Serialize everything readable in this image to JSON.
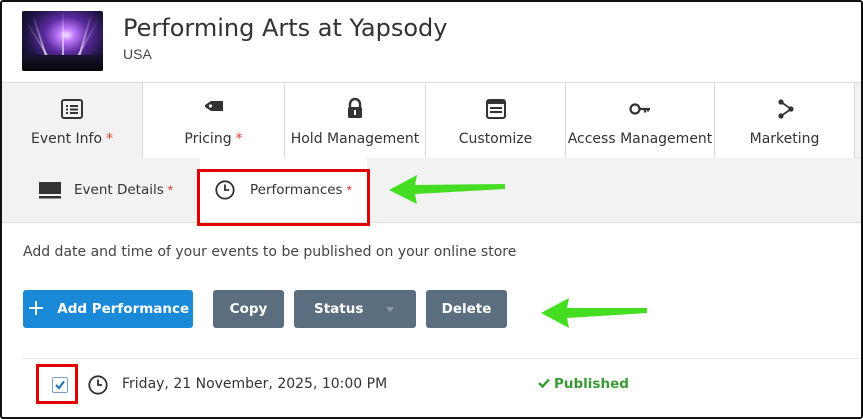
{
  "event": {
    "title": "Performing Arts at Yapsody",
    "location": "USA"
  },
  "main_tabs": [
    {
      "label": "Event Info",
      "required": "*",
      "icon": "list-icon"
    },
    {
      "label": "Pricing",
      "required": "*",
      "icon": "tag-icon"
    },
    {
      "label": "Hold Management",
      "icon": "lock-icon"
    },
    {
      "label": "Customize",
      "icon": "layout-icon"
    },
    {
      "label": "Access Management",
      "icon": "key-icon"
    },
    {
      "label": "Marketing",
      "icon": "share-icon"
    }
  ],
  "sub_tabs": [
    {
      "label": "Event Details",
      "required": "*",
      "icon": "monitor-icon"
    },
    {
      "label": "Performances",
      "required": "*",
      "icon": "clock-icon"
    }
  ],
  "description": "Add date and time of your events to be published on your online store",
  "actions": {
    "add_label": "Add Performance",
    "add_symbol": "+",
    "copy_label": "Copy",
    "status_label": "Status",
    "delete_label": "Delete"
  },
  "performances": [
    {
      "datetime": "Friday, 21 November, 2025, 10:00 PM",
      "status": "Published",
      "status_icon": "check-icon",
      "checked": true
    }
  ],
  "colors": {
    "primary": "#1a8ad8",
    "secondary_button": "#5b6e80",
    "published": "#3a9a35",
    "required": "#e53935",
    "highlight_box": "#e00000",
    "arrow": "#44dd22"
  }
}
